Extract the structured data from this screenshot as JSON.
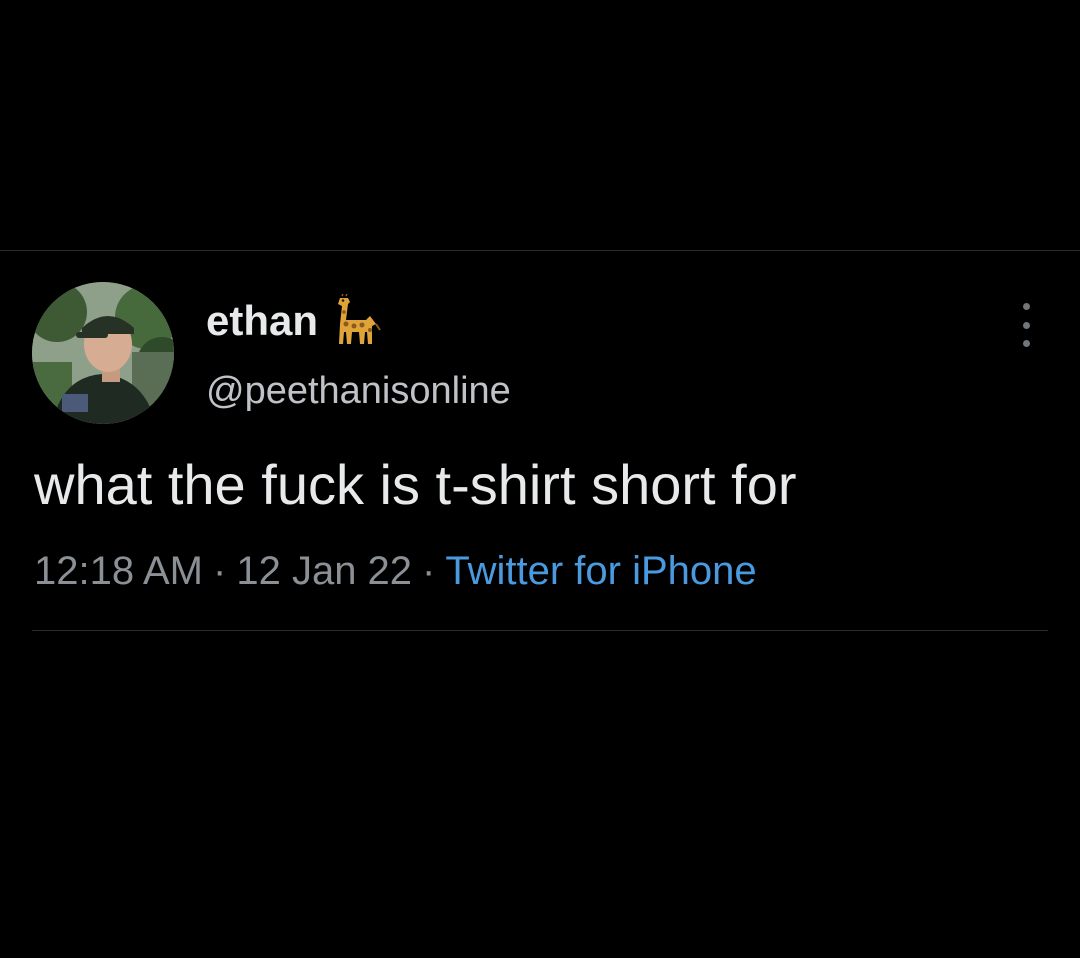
{
  "tweet": {
    "author": {
      "display_name": "ethan",
      "name_emoji_icon": "giraffe-icon",
      "handle": "@peethanisonline",
      "avatar_icon": "avatar"
    },
    "text": "what the fuck is t-shirt short for",
    "time": "12:18 AM",
    "separator": "·",
    "date": "12 Jan 22",
    "source": "Twitter for iPhone",
    "more_icon": "more-vertical-icon"
  },
  "colors": {
    "background": "#000000",
    "primary_text": "#e7e9ea",
    "secondary_text": "#8b9096",
    "link": "#4a9ae0",
    "divider": "#2a2d30"
  }
}
